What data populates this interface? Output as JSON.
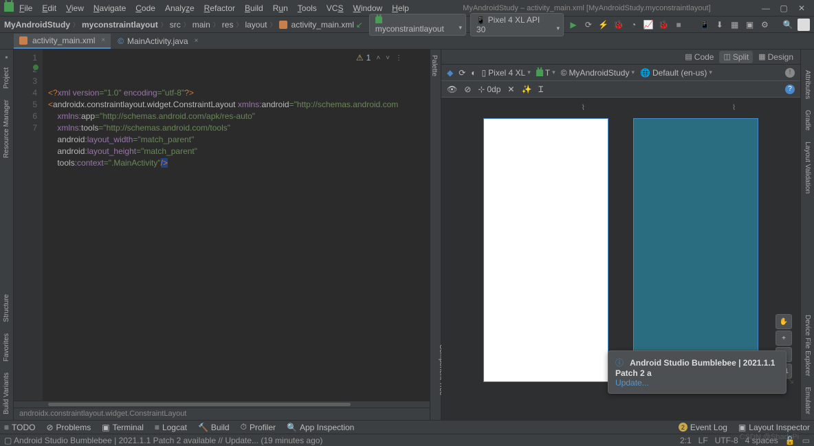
{
  "menu": {
    "file": "File",
    "edit": "Edit",
    "view": "View",
    "navigate": "Navigate",
    "code": "Code",
    "analyze": "Analyze",
    "refactor": "Refactor",
    "build": "Build",
    "run": "Run",
    "tools": "Tools",
    "vcs": "VCS",
    "window": "Window",
    "help": "Help"
  },
  "title": "MyAndroidStudy – activity_main.xml [MyAndroidStudy.myconstraintlayout]",
  "breadcrumbs": {
    "proj": "MyAndroidStudy",
    "mod": "myconstraintlayout",
    "src": "src",
    "main": "main",
    "res": "res",
    "layout": "layout",
    "file": "activity_main.xml"
  },
  "runconfig": {
    "module": "myconstraintlayout",
    "device": "Pixel 4 XL API 30"
  },
  "tabs": {
    "active": "activity_main.xml",
    "other": "MainActivity.java"
  },
  "left_rails": {
    "project": "Project",
    "resmgr": "Resource Manager",
    "struct": "Structure",
    "fav": "Favorites",
    "variants": "Build Variants"
  },
  "right_rails": {
    "gradle": "Gradle",
    "layout": "Layout Validation",
    "devfile": "Device File Explorer",
    "emu": "Emulator"
  },
  "design_rails": {
    "palette": "Palette",
    "tree": "Component Tree",
    "attrs": "Attributes"
  },
  "view_switch": {
    "code": "Code",
    "split": "Split",
    "design": "Design"
  },
  "design_tb": {
    "device": "Pixel 4 XL",
    "theme": "T",
    "app": "MyAndroidStudy",
    "locale": "Default (en-us)"
  },
  "design_tb2": {
    "zoom": "0dp"
  },
  "zoom": {
    "fit": "1:1",
    "plus": "+",
    "minus": "−"
  },
  "hand_icon": "✋",
  "editor": {
    "lines": [
      "1",
      "2",
      "3",
      "4",
      "5",
      "6",
      "7"
    ],
    "l1_a": "<?",
    "l1_b": "xml version",
    "l1_c": "=\"1.0\"",
    "l1_d": " encoding",
    "l1_e": "=\"utf-8\"",
    "l1_f": "?>",
    "l2_a": "<",
    "l2_b": "androidx.constraintlayout.widget.ConstraintLayout",
    "l2_c": " xmlns:",
    "l2_d": "android",
    "l2_e": "=\"http://schemas.android.com",
    "l3_a": "xmlns:",
    "l3_b": "app",
    "l3_c": "=\"http://schemas.android.com/apk/res-auto\"",
    "l4_a": "xmlns:",
    "l4_b": "tools",
    "l4_c": "=\"http://schemas.android.com/tools\"",
    "l5_a": "android",
    "l5_b": ":layout_width",
    "l5_c": "=\"match_parent\"",
    "l6_a": "android",
    "l6_b": ":layout_height",
    "l6_c": "=\"match_parent\"",
    "l7_a": "tools",
    "l7_b": ":context",
    "l7_c": "=\".MainActivity\"",
    "l7_d": "/>",
    "warn_count": "1",
    "crumb": "androidx.constraintlayout.widget.ConstraintLayout"
  },
  "tip": {
    "title": "Android Studio Bumblebee | 2021.1.1 Patch 2 a",
    "link": "Update...",
    "info": "ⓘ"
  },
  "bottom": {
    "todo": "TODO",
    "problems": "Problems",
    "terminal": "Terminal",
    "logcat": "Logcat",
    "build": "Build",
    "profiler": "Profiler",
    "inspection": "App Inspection",
    "eventlog": "Event Log",
    "layoutinsp": "Layout Inspector",
    "event_badge": "2"
  },
  "status": {
    "msg": "Android Studio Bumblebee | 2021.1.1 Patch 2 available // Update... (19 minutes ago)",
    "pos": "2:1",
    "lf": "LF",
    "enc": "UTF-8",
    "indent": "4 spaces"
  },
  "watermark": "CSDN @ShadyPi"
}
